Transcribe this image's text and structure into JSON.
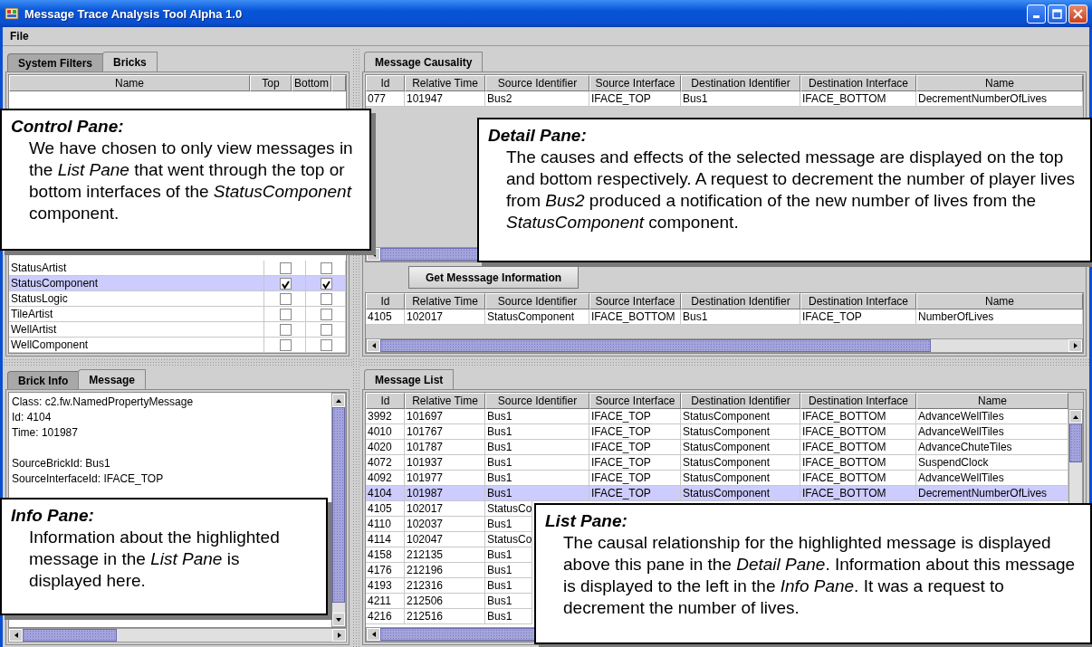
{
  "window": {
    "title": "Message Trace Analysis Tool Alpha 1.0"
  },
  "menu": [
    "File"
  ],
  "control_pane": {
    "tabs": [
      {
        "label": "System Filters",
        "selected": false
      },
      {
        "label": "Bricks",
        "selected": true
      }
    ],
    "columns": [
      "Name",
      "Top",
      "Bottom"
    ],
    "rows": [
      {
        "name": "StatusArtist",
        "top": false,
        "bottom": false,
        "selected": false
      },
      {
        "name": "StatusComponent",
        "top": true,
        "bottom": true,
        "selected": true
      },
      {
        "name": "StatusLogic",
        "top": false,
        "bottom": false,
        "selected": false
      },
      {
        "name": "TileArtist",
        "top": false,
        "bottom": false,
        "selected": false
      },
      {
        "name": "WellArtist",
        "top": false,
        "bottom": false,
        "selected": false
      },
      {
        "name": "WellComponent",
        "top": false,
        "bottom": false,
        "selected": false
      }
    ]
  },
  "detail_pane": {
    "tabs": [
      {
        "label": "Message Causality",
        "selected": true
      }
    ],
    "columns": [
      "Id",
      "Relative Time",
      "Source Identifier",
      "Source Interface",
      "Destination Identifier",
      "Destination Interface",
      "Name"
    ],
    "causes": [
      {
        "cells": [
          "077",
          "101947",
          "Bus2",
          "IFACE_TOP",
          "Bus1",
          "IFACE_BOTTOM",
          "DecrementNumberOfLives"
        ]
      }
    ],
    "button": "Get Messsage Information",
    "effect_columns": [
      "Id",
      "Relative Time",
      "Source Identifier",
      "Source Interface",
      "Destination Identifier",
      "Destination Interface",
      "Name"
    ],
    "effects": [
      {
        "cells": [
          "4105",
          "102017",
          "StatusComponent",
          "IFACE_BOTTOM",
          "Bus1",
          "IFACE_TOP",
          "NumberOfLives"
        ]
      }
    ]
  },
  "info_pane": {
    "tabs": [
      {
        "label": "Brick Info",
        "selected": false
      },
      {
        "label": "Message",
        "selected": true
      }
    ],
    "groups": [
      [
        "Class: c2.fw.NamedPropertyMessage",
        "Id: 4104",
        "Time: 101987"
      ],
      [
        "SourceBrickId: Bus1",
        "SourceInterfaceId: IFACE_TOP"
      ]
    ]
  },
  "list_pane": {
    "tabs": [
      {
        "label": "Message List",
        "selected": true
      }
    ],
    "columns": [
      "Id",
      "Relative Time",
      "Source Identifier",
      "Source Interface",
      "Destination Identifier",
      "Destination Interface",
      "Name"
    ],
    "rows": [
      {
        "cells": [
          "3992",
          "101697",
          "Bus1",
          "IFACE_TOP",
          "StatusComponent",
          "IFACE_BOTTOM",
          "AdvanceWellTiles"
        ],
        "selected": false
      },
      {
        "cells": [
          "4010",
          "101767",
          "Bus1",
          "IFACE_TOP",
          "StatusComponent",
          "IFACE_BOTTOM",
          "AdvanceWellTiles"
        ],
        "selected": false
      },
      {
        "cells": [
          "4020",
          "101787",
          "Bus1",
          "IFACE_TOP",
          "StatusComponent",
          "IFACE_BOTTOM",
          "AdvanceChuteTiles"
        ],
        "selected": false
      },
      {
        "cells": [
          "4072",
          "101937",
          "Bus1",
          "IFACE_TOP",
          "StatusComponent",
          "IFACE_BOTTOM",
          "SuspendClock"
        ],
        "selected": false
      },
      {
        "cells": [
          "4092",
          "101977",
          "Bus1",
          "IFACE_TOP",
          "StatusComponent",
          "IFACE_BOTTOM",
          "AdvanceWellTiles"
        ],
        "selected": false
      },
      {
        "cells": [
          "4104",
          "101987",
          "Bus1",
          "IFACE_TOP",
          "StatusComponent",
          "IFACE_BOTTOM",
          "DecrementNumberOfLives"
        ],
        "selected": true
      },
      {
        "cells": [
          "4105",
          "102017",
          "StatusCo"
        ],
        "selected": false
      },
      {
        "cells": [
          "4110",
          "102037",
          "Bus1"
        ],
        "selected": false
      },
      {
        "cells": [
          "4114",
          "102047",
          "StatusCo"
        ],
        "selected": false
      },
      {
        "cells": [
          "4158",
          "212135",
          "Bus1"
        ],
        "selected": false
      },
      {
        "cells": [
          "4176",
          "212196",
          "Bus1"
        ],
        "selected": false
      },
      {
        "cells": [
          "4193",
          "212316",
          "Bus1"
        ],
        "selected": false
      },
      {
        "cells": [
          "4211",
          "212506",
          "Bus1"
        ],
        "selected": false
      },
      {
        "cells": [
          "4216",
          "212516",
          "Bus1"
        ],
        "selected": false
      }
    ]
  },
  "callouts": [
    {
      "title": "Control Pane:",
      "text": "We have chosen to only view messages in the *List Pane* that went through the top or bottom interfaces of the *StatusComponent* component."
    },
    {
      "title": "Detail Pane:",
      "text": "The causes and effects of the selected message are displayed on the top and bottom respectively. A request to decrement the number of player lives from *Bus2* produced a notification of the new number of lives from the *StatusComponent* component."
    },
    {
      "title": "Info Pane:",
      "text": "Information about the highlighted message in the *List Pane* is displayed here."
    },
    {
      "title": "List Pane:",
      "text": "The causal relationship for the highlighted message is displayed above this pane in the *Detail Pane*. Information about this message is displayed to the left in the *Info Pane*. It was a request to decrement the number of lives."
    }
  ]
}
